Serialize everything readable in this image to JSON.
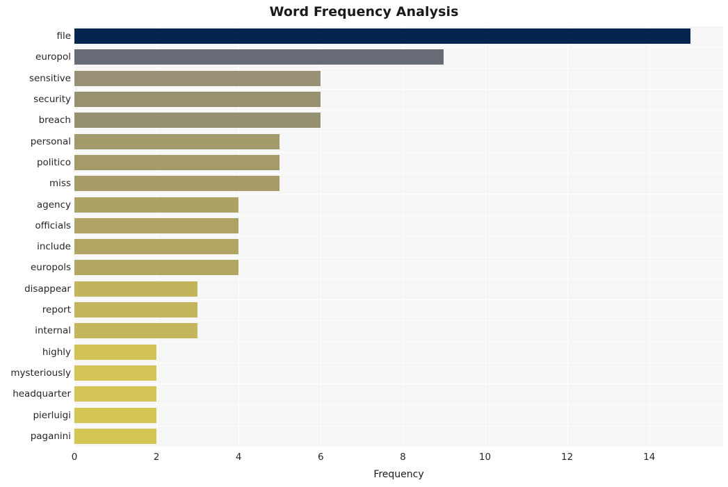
{
  "chart_data": {
    "type": "bar",
    "orientation": "horizontal",
    "title": "Word Frequency Analysis",
    "xlabel": "Frequency",
    "ylabel": "",
    "categories": [
      "file",
      "europol",
      "sensitive",
      "security",
      "breach",
      "personal",
      "politico",
      "miss",
      "agency",
      "officials",
      "include",
      "europols",
      "disappear",
      "report",
      "internal",
      "highly",
      "mysteriously",
      "headquarter",
      "pierluigi",
      "paganini"
    ],
    "values": [
      15,
      9,
      6,
      6,
      6,
      5,
      5,
      5,
      4,
      4,
      4,
      4,
      3,
      3,
      3,
      2,
      2,
      2,
      2,
      2
    ],
    "bar_colors": [
      "#04254f",
      "#676b76",
      "#989175",
      "#979170",
      "#95906f",
      "#a39a6c",
      "#a59b68",
      "#a69c67",
      "#ad a265",
      "#aea365",
      "#b0a563",
      "#b1a662",
      "#c2b45c",
      "#c3b55b",
      "#c4b65b",
      "#d3c355",
      "#d4c455",
      "#d4c455",
      "#d5c554",
      "#d5c554"
    ],
    "xlim": [
      0,
      15.8
    ],
    "xticks": [
      0,
      2,
      4,
      6,
      8,
      10,
      12,
      14
    ],
    "xticklabels": [
      "0",
      "2",
      "4",
      "6",
      "8",
      "10",
      "12",
      "14"
    ],
    "grid": true,
    "grid_color": "#ffffff",
    "plot_background": "#f6f6f6",
    "figure_background": "#ffffff",
    "legend": null
  }
}
